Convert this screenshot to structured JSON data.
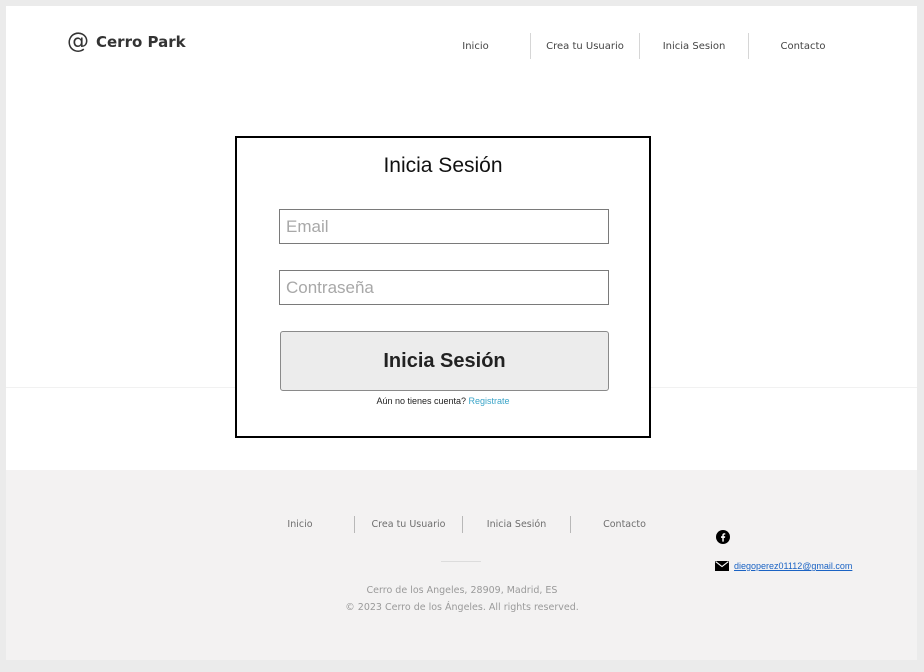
{
  "brand": {
    "icon_symbol": "@",
    "name": "Cerro Park"
  },
  "nav": {
    "items": [
      {
        "label": "Inicio"
      },
      {
        "label": "Crea tu Usuario"
      },
      {
        "label": "Inicia Sesion"
      },
      {
        "label": "Contacto"
      }
    ]
  },
  "login": {
    "title": "Inicia Sesión",
    "email_placeholder": "Email",
    "password_placeholder": "Contraseña",
    "submit_label": "Inicia Sesión",
    "register_prompt": "Aún no tienes cuenta?",
    "register_link": "Registrate",
    "link_color": "#3aa4c8"
  },
  "footer": {
    "nav": [
      {
        "label": "Inicio"
      },
      {
        "label": "Crea tu Usuario"
      },
      {
        "label": "Inicia Sesión"
      },
      {
        "label": "Contacto"
      }
    ],
    "address": "Cerro de los Angeles, 28909, Madrid, ES",
    "copyright": "© 2023 Cerro de los Ángeles.  All rights reserved.",
    "social_icon": "facebook-icon",
    "contact_icon": "mail-icon",
    "email": "diegoperez01112@gmail.com"
  }
}
